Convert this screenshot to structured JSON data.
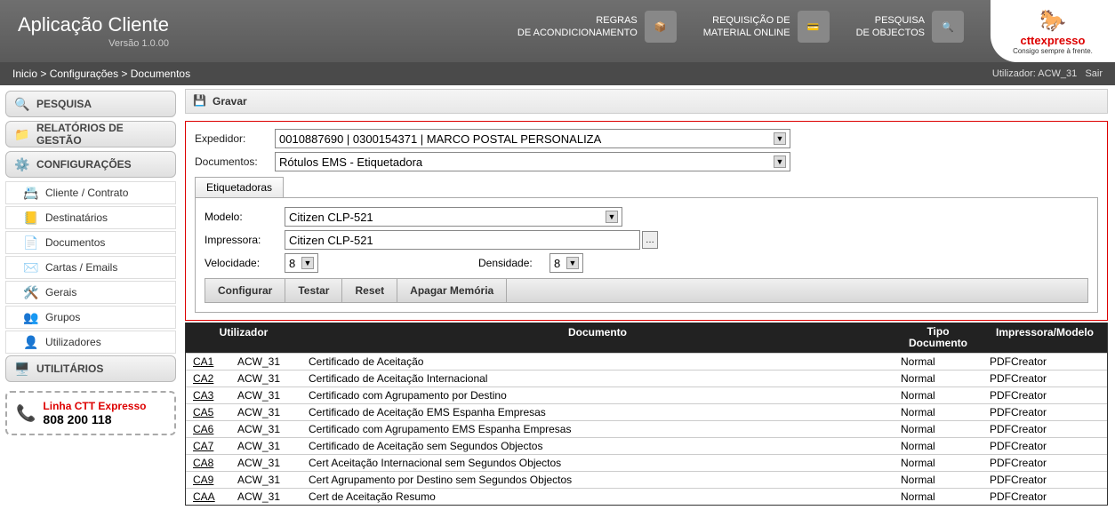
{
  "app": {
    "title": "Aplicação Cliente",
    "version": "Versão 1.0.00"
  },
  "headerLinks": {
    "regras": "REGRAS\nDE ACONDICIONAMENTO",
    "requisicao": "REQUISIÇÃO DE\nMATERIAL ONLINE",
    "pesquisa": "PESQUISA\nDE OBJECTOS"
  },
  "logo": {
    "brand": "cttexpresso",
    "slogan": "Consigo sempre à frente."
  },
  "breadcrumb": {
    "path": "Inicio > Configurações > Documentos",
    "user_label": "Utilizador: ACW_31",
    "exit": "Sair"
  },
  "sidebar": {
    "pesquisa": "PESQUISA",
    "relatorios": "RELATÓRIOS DE GESTÃO",
    "config": "CONFIGURAÇÕES",
    "subs": {
      "cliente": "Cliente / Contrato",
      "dest": "Destinatários",
      "docs": "Documentos",
      "cartas": "Cartas / Emails",
      "gerais": "Gerais",
      "grupos": "Grupos",
      "util": "Utilizadores"
    },
    "utilitarios": "UTILITÁRIOS",
    "phone": {
      "label": "Linha CTT Expresso",
      "number": "808 200 118"
    }
  },
  "toolbar": {
    "gravar": "Gravar"
  },
  "form": {
    "expedidor_label": "Expedidor:",
    "expedidor_value": "0010887690 | 0300154371 | MARCO POSTAL PERSONALIZA",
    "documentos_label": "Documentos:",
    "documentos_value": "Rótulos EMS - Etiquetadora",
    "tab": "Etiquetadoras",
    "modelo_label": "Modelo:",
    "modelo_value": "Citizen CLP-521",
    "impressora_label": "Impressora:",
    "impressora_value": "Citizen CLP-521",
    "velocidade_label": "Velocidade:",
    "velocidade_value": "8",
    "densidade_label": "Densidade:",
    "densidade_value": "8",
    "actions": {
      "configurar": "Configurar",
      "testar": "Testar",
      "reset": "Reset",
      "apagar": "Apagar Memória"
    }
  },
  "grid": {
    "headers": {
      "user": "Utilizador",
      "doc": "Documento",
      "tipo": "Tipo\nDocumento",
      "imp": "Impressora/Modelo"
    },
    "rows": [
      {
        "code": "CA1",
        "user": "ACW_31",
        "doc": "Certificado de Aceitação",
        "tipo": "Normal",
        "imp": "PDFCreator"
      },
      {
        "code": "CA2",
        "user": "ACW_31",
        "doc": "Certificado de Aceitação Internacional",
        "tipo": "Normal",
        "imp": "PDFCreator"
      },
      {
        "code": "CA3",
        "user": "ACW_31",
        "doc": "Certificado com Agrupamento por Destino",
        "tipo": "Normal",
        "imp": "PDFCreator"
      },
      {
        "code": "CA5",
        "user": "ACW_31",
        "doc": "Certificado de Aceitação EMS Espanha Empresas",
        "tipo": "Normal",
        "imp": "PDFCreator"
      },
      {
        "code": "CA6",
        "user": "ACW_31",
        "doc": "Certificado com Agrupamento EMS Espanha Empresas",
        "tipo": "Normal",
        "imp": "PDFCreator"
      },
      {
        "code": "CA7",
        "user": "ACW_31",
        "doc": "Certificado de Aceitação sem Segundos Objectos",
        "tipo": "Normal",
        "imp": "PDFCreator"
      },
      {
        "code": "CA8",
        "user": "ACW_31",
        "doc": "Cert Aceitação Internacional sem Segundos Objectos",
        "tipo": "Normal",
        "imp": "PDFCreator"
      },
      {
        "code": "CA9",
        "user": "ACW_31",
        "doc": "Cert Agrupamento por Destino sem Segundos Objectos",
        "tipo": "Normal",
        "imp": "PDFCreator"
      },
      {
        "code": "CAA",
        "user": "ACW_31",
        "doc": "Cert de Aceitação Resumo",
        "tipo": "Normal",
        "imp": "PDFCreator"
      }
    ]
  }
}
